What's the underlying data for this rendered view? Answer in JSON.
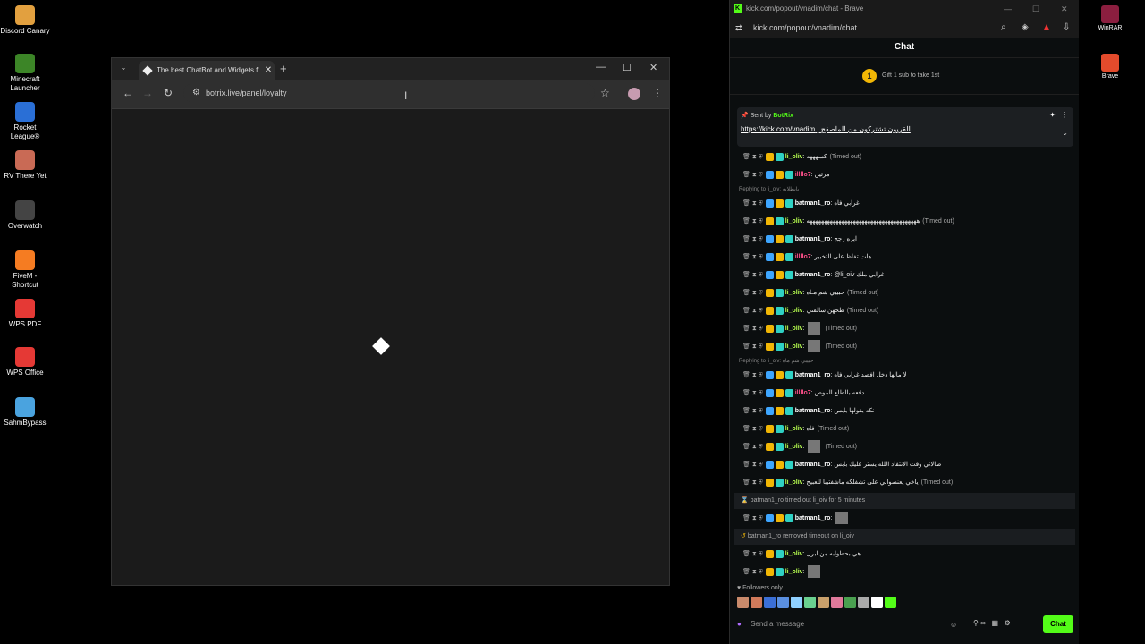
{
  "desktop": {
    "icons": [
      {
        "label": "Discord Canary",
        "icon": "discord-icon",
        "color": "#e2a03f"
      },
      {
        "label": "Minecraft Launcher",
        "icon": "minecraft-icon",
        "color": "#3c8527"
      },
      {
        "label": "Rocket League®",
        "icon": "rocket-league-icon",
        "color": "#2a6fd6"
      },
      {
        "label": "RV There Yet",
        "icon": "rv-icon",
        "color": "#c96a55"
      },
      {
        "label": "Overwatch",
        "icon": "overwatch-icon",
        "color": "#444444"
      },
      {
        "label": "FiveM - Shortcut",
        "icon": "fivem-icon",
        "color": "#f57c22"
      },
      {
        "label": "WPS PDF",
        "icon": "wps-pdf-icon",
        "color": "#e53935"
      },
      {
        "label": "WPS Office",
        "icon": "wps-office-icon",
        "color": "#e53935"
      },
      {
        "label": "SahmBypass",
        "icon": "sahm-icon",
        "color": "#4aa3df"
      }
    ],
    "right_icons": [
      {
        "label": "WinRAR",
        "icon": "winrar-icon"
      },
      {
        "label": "Brave",
        "icon": "brave-icon"
      }
    ]
  },
  "window1": {
    "tab_title": "The best ChatBot and Widgets f",
    "url": "botrix.live/panel/loyalty"
  },
  "window2": {
    "title": "kick.com/popout/vnadim/chat - Brave",
    "url": "kick.com/popout/vnadim/chat",
    "chat_header": "Chat",
    "gift_count": "1",
    "gift_text": "Gift 1 sub to take 1st",
    "pinned_sent_by": "Sent by",
    "pinned_bot": "BotRix",
    "pinned_link": "https://kick.com/vnadim",
    "pinned_text": "| القريون تشتركون من الماصفح",
    "followers_only": "Followers only",
    "input_placeholder": "Send a message",
    "chat_button": "Chat"
  },
  "messages": [
    {
      "type": "msg",
      "user": "li_oliv",
      "color": "u-green",
      "text": "كسهههه",
      "suffix": "(Timed out)"
    },
    {
      "type": "msg",
      "user": "illllo7",
      "color": "u-pink",
      "text": "مرتين",
      "suffix": ""
    },
    {
      "type": "reply",
      "text": "Replying to li_oiv: يابطلابه"
    },
    {
      "type": "msg",
      "user": "batman1_ro",
      "color": "u-white",
      "text": "غرابي فاه",
      "suffix": ""
    },
    {
      "type": "msg",
      "user": "li_oliv",
      "color": "u-green",
      "text": "ههههههههههههههههههههههههههههههههههههههه",
      "suffix": "(Timed out)"
    },
    {
      "type": "msg",
      "user": "batman1_ro",
      "color": "u-white",
      "text": "ابره زجج",
      "suffix": ""
    },
    {
      "type": "msg",
      "user": "illllo7",
      "color": "u-pink",
      "text": "هلت تفاظ على التخبير",
      "suffix": ""
    },
    {
      "type": "msg",
      "user": "batman1_ro",
      "color": "u-white",
      "text": "@li_oiv غرابي ملك",
      "suffix": ""
    },
    {
      "type": "msg",
      "user": "li_oliv",
      "color": "u-green",
      "text": "حبيبي شم مـاه",
      "suffix": "(Timed out)"
    },
    {
      "type": "msg",
      "user": "li_oliv",
      "color": "u-green",
      "text": "طخهن سالفتي",
      "suffix": "(Timed out)"
    },
    {
      "type": "msg",
      "user": "li_oliv",
      "color": "u-green",
      "text": "",
      "suffix": "(Timed out)",
      "emote": true
    },
    {
      "type": "msg",
      "user": "li_oliv",
      "color": "u-green",
      "text": "",
      "suffix": "(Timed out)",
      "emote": true
    },
    {
      "type": "reply",
      "text": "Replying to li_oiv: حبيبي شم ماه"
    },
    {
      "type": "msg",
      "user": "batman1_ro",
      "color": "u-white",
      "text": "لا مالها دخل افصد غرابي فاه",
      "suffix": ""
    },
    {
      "type": "msg",
      "user": "illllo7",
      "color": "u-pink",
      "text": "دفعه بالطلع الموص",
      "suffix": ""
    },
    {
      "type": "msg",
      "user": "batman1_ro",
      "color": "u-white",
      "text": "نكه بقولها بابس",
      "suffix": ""
    },
    {
      "type": "msg",
      "user": "li_oliv",
      "color": "u-green",
      "text": "فاه",
      "suffix": "(Timed out)"
    },
    {
      "type": "msg",
      "user": "li_oliv",
      "color": "u-green",
      "text": "",
      "suffix": "(Timed out)",
      "emote": true
    },
    {
      "type": "msg",
      "user": "batman1_ro",
      "color": "u-white",
      "text": "صالاتي وقت الانتفاد اللله يستر عليك بابس",
      "suffix": ""
    },
    {
      "type": "msg",
      "user": "li_oliv",
      "color": "u-green",
      "text": "ياخي يعنصواني على تشفلكه ماشفتيبا للعبيج",
      "suffix": "(Timed out)"
    },
    {
      "type": "sys",
      "icon": "hourglass-icon",
      "text": "batman1_ro timed out li_oiv for 5 minutes"
    },
    {
      "type": "msg",
      "user": "batman1_ro",
      "color": "u-white",
      "text": "",
      "suffix": "",
      "emote": true
    },
    {
      "type": "sys",
      "icon": "undo-icon",
      "text": "batman1_ro removed timeout on li_oiv"
    },
    {
      "type": "msg",
      "user": "li_oliv",
      "color": "u-green",
      "text": "هي بحطوابه من ابرل",
      "suffix": ""
    },
    {
      "type": "msg",
      "user": "li_oliv",
      "color": "u-green",
      "text": "",
      "suffix": "",
      "emote": true
    }
  ],
  "emote_colors": [
    "#c98a6b",
    "#d07a5b",
    "#3b6fd6",
    "#5a8fe0",
    "#8fd0ff",
    "#6ad08f",
    "#c9a06b",
    "#e07a9b",
    "#4aa050",
    "#aaaaaa",
    "#ffffff",
    "#53fc18"
  ]
}
